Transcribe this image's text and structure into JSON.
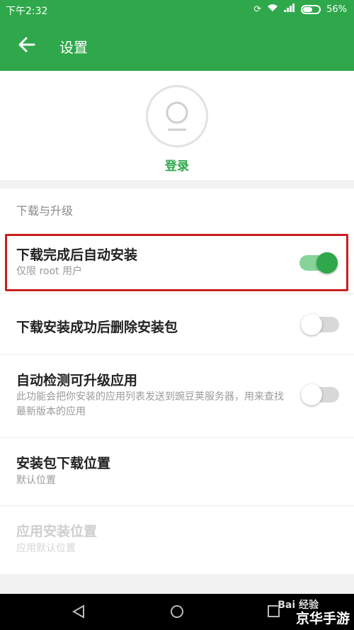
{
  "status_bar": {
    "time": "下午2:32",
    "battery": "56%"
  },
  "app_bar": {
    "title": "设置"
  },
  "profile": {
    "login_label": "登录"
  },
  "section": {
    "header": "下载与升级"
  },
  "settings": [
    {
      "title": "下载完成后自动安装",
      "subtitle": "仅限 root 用户",
      "toggle": "on",
      "highlighted": true
    },
    {
      "title": "下载安装成功后删除安装包",
      "toggle": "off"
    },
    {
      "title": "自动检测可升级应用",
      "subtitle": "此功能会把你安装的应用列表发送到豌豆荚服务器，用来查找最新版本的应用",
      "toggle": "off"
    },
    {
      "title": "安装包下载位置",
      "subtitle": "默认位置"
    },
    {
      "title": "应用安装位置",
      "subtitle": "应用默认位置",
      "disabled": true
    }
  ],
  "watermark": {
    "text": "京华手游",
    "baidu": "Bai 经验"
  },
  "colors": {
    "accent": "#2ea84a",
    "highlight_border": "#c91f1f"
  }
}
